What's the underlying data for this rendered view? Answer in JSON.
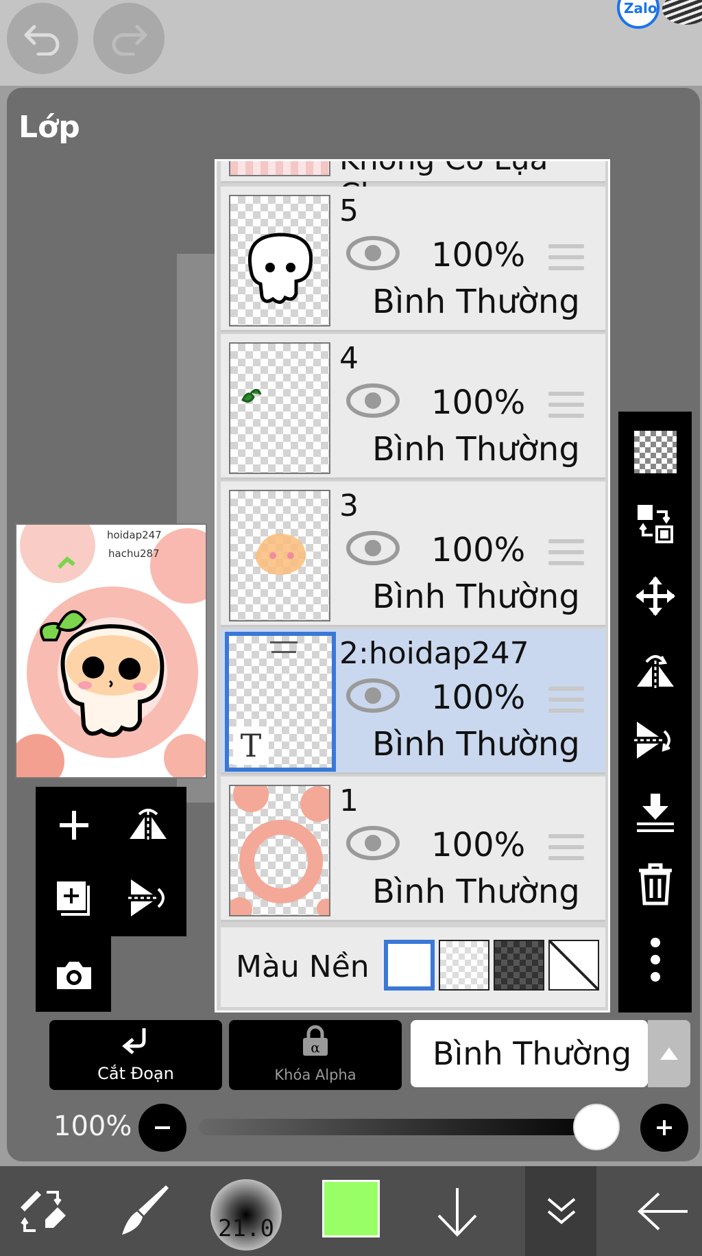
{
  "topbar": {
    "undo_icon": "undo-icon",
    "redo_icon": "redo-icon",
    "notification_app": "Zalo"
  },
  "panel": {
    "title": "Lớp"
  },
  "preview": {
    "watermark_line1": "hoidap247",
    "watermark_line2": "hachu287"
  },
  "layers": {
    "selection_row_label": "Không Có Lựa Chọn",
    "items": [
      {
        "name": "5",
        "opacity": "100%",
        "blend": "Bình Thường",
        "selected": false
      },
      {
        "name": "4",
        "opacity": "100%",
        "blend": "Bình Thường",
        "selected": false
      },
      {
        "name": "3",
        "opacity": "100%",
        "blend": "Bình Thường",
        "selected": false
      },
      {
        "name": "2:hoidap247",
        "opacity": "100%",
        "blend": "Bình Thường",
        "selected": true,
        "text_layer_badge": "T"
      },
      {
        "name": "1",
        "opacity": "100%",
        "blend": "Bình Thường",
        "selected": false
      }
    ],
    "background": {
      "label": "Màu Nền",
      "options": [
        "white",
        "transparent-light",
        "transparent-dark",
        "none"
      ],
      "selected": "white"
    }
  },
  "actions": {
    "clipping_label": "Cắt Đoạn",
    "alpha_lock_label": "Khóa Alpha",
    "blend_mode": "Bình Thường"
  },
  "opacity": {
    "label": "100%",
    "value_percent": 100
  },
  "bottom": {
    "brush_size": "21.0",
    "color": "#99ff66"
  },
  "colors": {
    "accent": "#3a78d8",
    "selected_row": "#c9d8ee"
  }
}
